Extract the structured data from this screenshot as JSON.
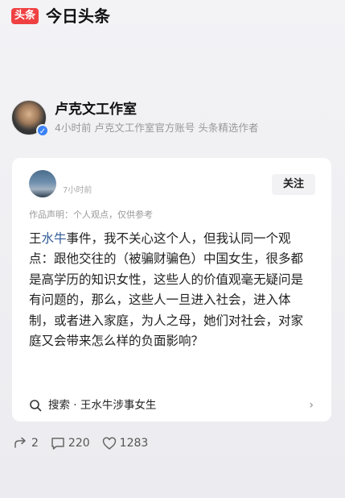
{
  "app": {
    "logo_text": "头条",
    "title": "今日头条",
    "brand_color": "#f04142"
  },
  "author": {
    "name": "卢克文工作室",
    "meta": "4小时前 卢克文工作室官方账号 头条精选作者",
    "verified_icon": "check-icon",
    "verified_color": "#3b82f6"
  },
  "card": {
    "quoted_user": {
      "name": " ",
      "time": "7小时前"
    },
    "follow_label": "关注",
    "statement": "作品声明：个人观点，仅供参考",
    "body_prefix": "王",
    "body_highlight": "水牛",
    "body_rest": "事件，我不关心这个人，但我认同一个观点：跟他交往的（被骗财骗色）中国女生，很多都是高学历的知识女性，这些人的价值观毫无疑问是有问题的，那么，这些人一旦进入社会，进入体制，或者进入家庭，为人之母，她们对社会，对家庭又会带来怎么样的负面影响？",
    "highlight_color": "#2f5a96",
    "search_label": "搜索 · 王水牛涉事女生",
    "search_icon": "search-icon",
    "chevron_icon": "chevron-right-icon"
  },
  "actions": {
    "repost_count": "2",
    "comment_count": "220",
    "like_count": "1283"
  }
}
